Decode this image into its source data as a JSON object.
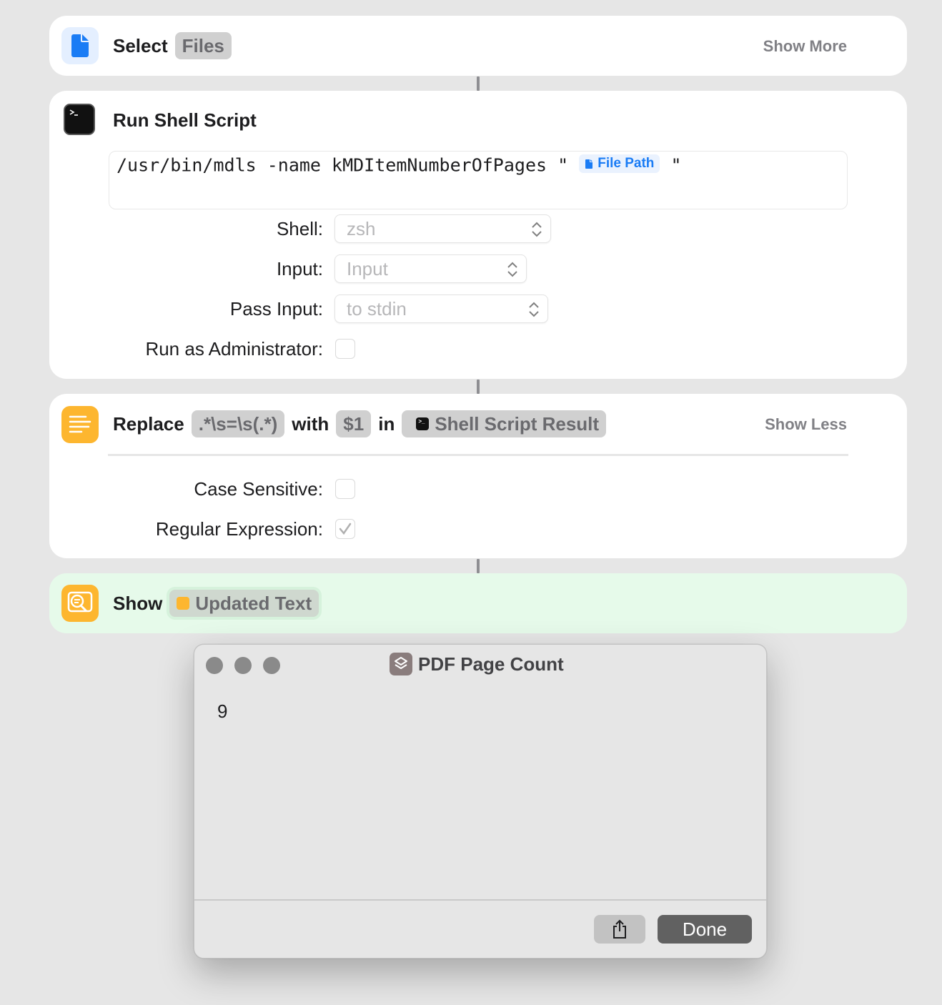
{
  "select_action": {
    "verb": "Select",
    "token": "Files",
    "toggle": "Show More",
    "icon": "document-icon",
    "color": "#1a7cf5"
  },
  "shell_action": {
    "title": "Run Shell Script",
    "icon": "terminal-icon",
    "script_text": "/usr/bin/mdls -name kMDItemNumberOfPages \"",
    "script_close": "\"",
    "file_token": "File Path",
    "shell_label": "Shell:",
    "shell_value": "zsh",
    "input_label": "Input:",
    "input_value": "Input",
    "pass_label": "Pass Input:",
    "pass_value": "to stdin",
    "admin_label": "Run as Administrator:"
  },
  "replace_action": {
    "verb": "Replace",
    "pattern": ".*\\s=\\s(.*)",
    "with_word": "with",
    "replacement": "$1",
    "in_word": "in",
    "target": "Shell Script Result",
    "toggle": "Show Less",
    "icon": "text-icon",
    "color": "#fdb62f",
    "case_label": "Case Sensitive:",
    "regex_label": "Regular Expression:",
    "case_checked": false,
    "regex_checked": true
  },
  "show_action": {
    "verb": "Show",
    "token": "Updated Text",
    "icon": "quick-look-icon",
    "color": "#fdb62f"
  },
  "dialog": {
    "title": "PDF Page Count",
    "result": "9",
    "done_label": "Done",
    "icon": "shortcuts-icon"
  }
}
